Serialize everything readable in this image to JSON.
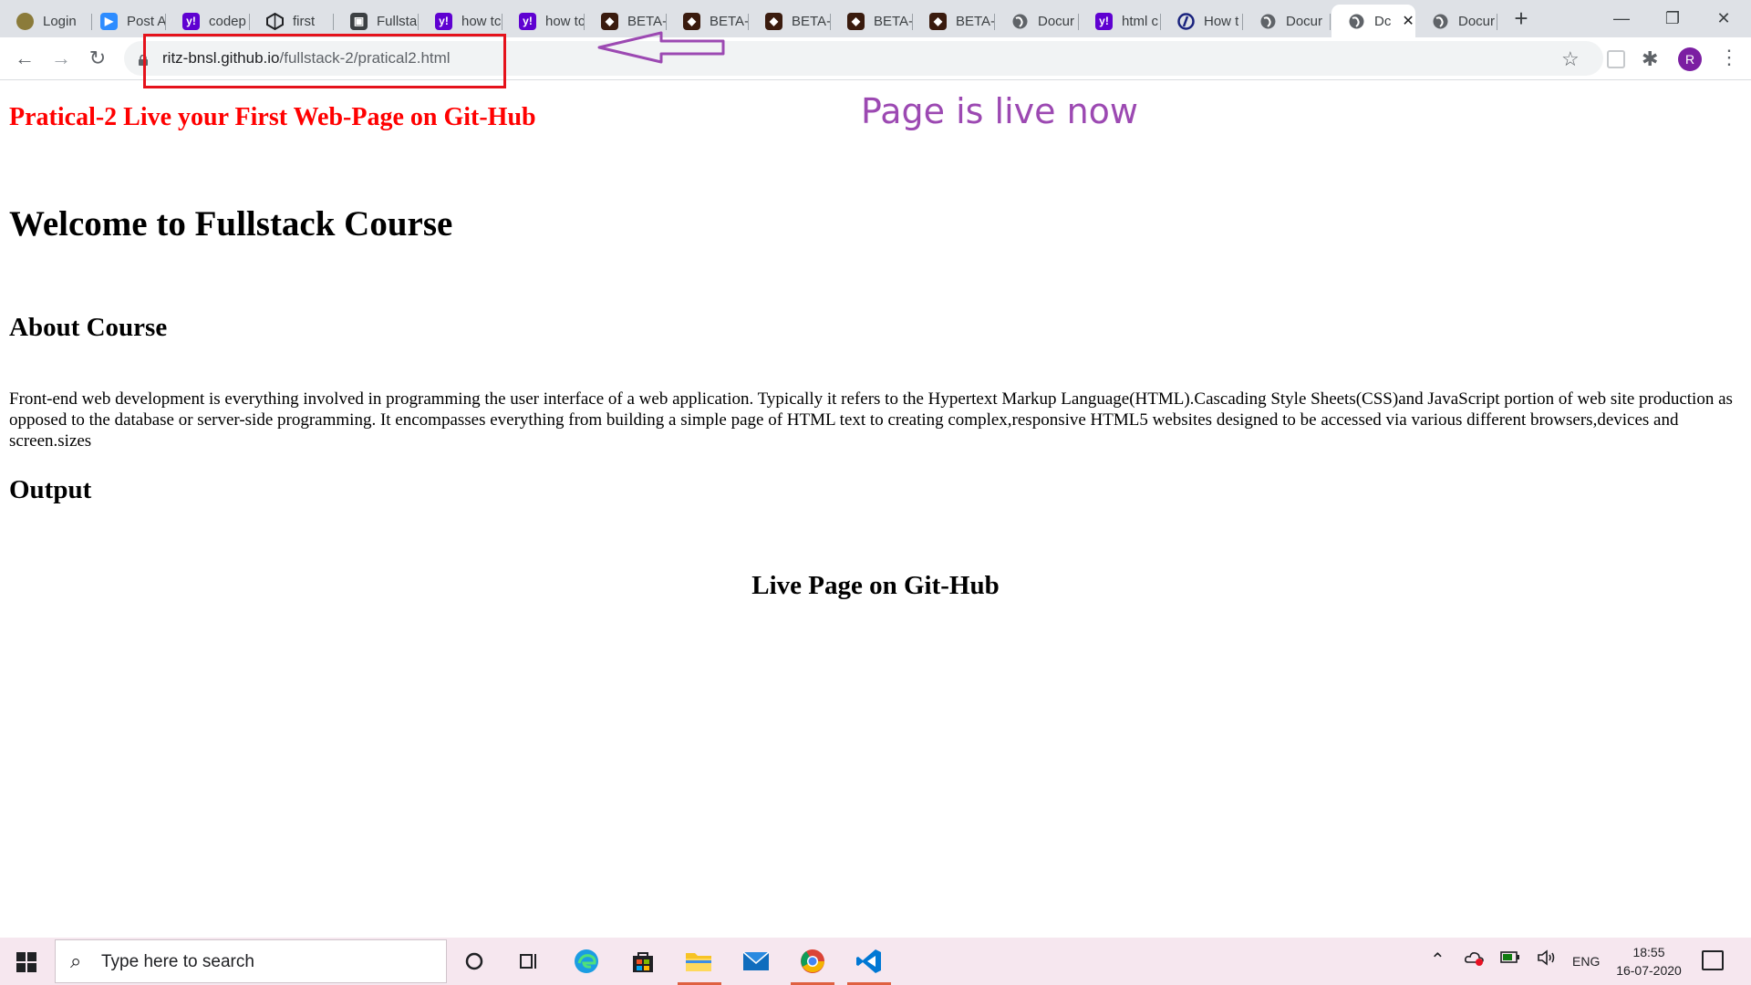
{
  "browser": {
    "tabs": [
      {
        "title": "Login",
        "icon": "login-favicon",
        "state": "inactive"
      },
      {
        "title": "Post A",
        "icon": "zoom-favicon",
        "state": "inactive"
      },
      {
        "title": "codep",
        "icon": "yahoo-favicon",
        "state": "inactive"
      },
      {
        "title": "first",
        "icon": "codepen-favicon",
        "state": "inactive"
      },
      {
        "title": "Fullsta",
        "icon": "document-favicon",
        "state": "inactive"
      },
      {
        "title": "how tc",
        "icon": "yahoo-favicon",
        "state": "inactive"
      },
      {
        "title": "how tc",
        "icon": "yahoo-favicon",
        "state": "inactive"
      },
      {
        "title": "BETA-",
        "icon": "beta-favicon",
        "state": "inactive"
      },
      {
        "title": "BETA-",
        "icon": "beta-favicon",
        "state": "inactive"
      },
      {
        "title": "BETA-",
        "icon": "beta-favicon",
        "state": "inactive"
      },
      {
        "title": "BETA-",
        "icon": "beta-favicon",
        "state": "inactive"
      },
      {
        "title": "BETA-",
        "icon": "beta-favicon",
        "state": "inactive"
      },
      {
        "title": "Docur",
        "icon": "globe-favicon",
        "state": "inactive"
      },
      {
        "title": "html c",
        "icon": "yahoo-favicon",
        "state": "inactive"
      },
      {
        "title": "How t",
        "icon": "howto-favicon",
        "state": "inactive"
      },
      {
        "title": "Docur",
        "icon": "globe-favicon",
        "state": "inactive"
      },
      {
        "title": "Dc",
        "icon": "globe-favicon",
        "state": "active"
      },
      {
        "title": "Docur",
        "icon": "globe-favicon",
        "state": "inactive"
      }
    ],
    "new_tab_symbol": "+",
    "window_controls": {
      "minimize": "—",
      "maximize": "❐",
      "close": "✕"
    },
    "tab_close_symbol": "✕",
    "nav": {
      "back": "←",
      "forward": "→",
      "reload": "↻"
    },
    "address": {
      "host": "ritz-bnsl.github.io",
      "path": "/fullstack-2/pratical2.html"
    },
    "star_symbol": "☆",
    "extensions_symbol": "✱",
    "profile_initial": "R",
    "menu_symbol": "⋮"
  },
  "annotations": {
    "box_color": "#e5121b",
    "arrow_color": "#9c49b2",
    "note": "Page is live now"
  },
  "page": {
    "title": "Pratical-2 Live your First Web-Page on Git-Hub",
    "title_color": "#ff0000",
    "welcome_heading": "Welcome to Fullstack Course",
    "about_heading": "About Course",
    "about_paragraph": "Front-end web development is everything involved in programming the user interface of a web application. Typically it refers to the Hypertext Markup Language(HTML).Cascading Style Sheets(CSS)and JavaScript portion of web site production as opposed to the database or server-side programming. It encompasses everything from building a simple page of HTML text to creating complex,responsive HTML5 websites designed to be accessed via various different browsers,devices and screen.sizes",
    "output_heading": "Output",
    "live_heading": "Live Page on Git-Hub"
  },
  "taskbar": {
    "search_placeholder": "Type here to search",
    "apps": [
      "cortana-icon",
      "task-view-icon",
      "edge-icon",
      "store-icon",
      "file-explorer-icon",
      "mail-icon",
      "chrome-icon",
      "vscode-icon"
    ],
    "tray": {
      "language": "ENG",
      "caret": "^"
    },
    "clock": {
      "time": "18:55",
      "date": "16-07-2020"
    }
  }
}
